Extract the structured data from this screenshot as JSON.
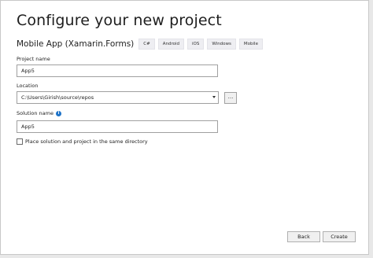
{
  "dialog": {
    "title": "Configure your new project"
  },
  "template": {
    "name": "Mobile App (Xamarin.Forms)",
    "tags": [
      "C#",
      "Android",
      "iOS",
      "Windows",
      "Mobile"
    ]
  },
  "project_name": {
    "label": "Project name",
    "value": "App5"
  },
  "location": {
    "label": "Location",
    "value": "C:\\Users\\Girish\\source\\repos",
    "browse_label": "..."
  },
  "solution_name": {
    "label": "Solution name",
    "info_icon": "i",
    "value": "App5"
  },
  "same_directory": {
    "label": "Place solution and project in the same directory",
    "checked": false
  },
  "footer": {
    "back_label": "Back",
    "create_label": "Create"
  }
}
